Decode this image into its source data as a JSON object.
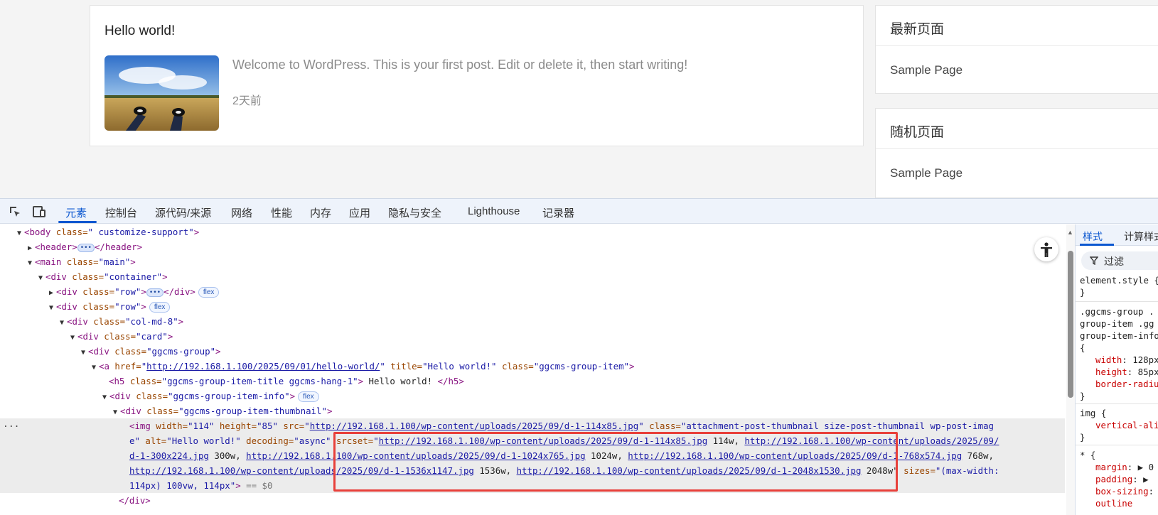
{
  "page": {
    "post": {
      "title": "Hello world!",
      "excerpt": "Welcome to WordPress. This is your first post. Edit or delete it, then start writing!",
      "time": "2天前"
    },
    "widgets": [
      {
        "title": "最新页面",
        "item": "Sample Page"
      },
      {
        "title": "随机页面",
        "item": "Sample Page"
      }
    ]
  },
  "devtools": {
    "toolbar_icons": [
      "inspect-element-icon",
      "device-toolbar-icon"
    ],
    "tabs": [
      {
        "label": "元素",
        "active": true
      },
      {
        "label": "控制台"
      },
      {
        "label": "源代码/来源"
      },
      {
        "label": "网络"
      },
      {
        "label": "性能"
      },
      {
        "label": "内存"
      },
      {
        "label": "应用"
      },
      {
        "label": "隐私与安全"
      },
      {
        "label": "Lighthouse"
      },
      {
        "label": "记录器"
      }
    ],
    "dom": {
      "body_tag": "<body",
      "body_attr": " class=",
      "body_val": "\" customize-support\"",
      "body_close": ">",
      "header_open": "<header>",
      "header_close": "</header>",
      "main_open": "<main",
      "main_attr": " class=",
      "main_val": "\"main\"",
      "container_open": "<div",
      "container_attr": " class=",
      "container_val": "\"container\"",
      "row_val": "\"row\"",
      "div_close": "</div>",
      "badge_flex": "flex",
      "col_val": "\"col-md-8\"",
      "card_val": "\"card\"",
      "group_val": "\"ggcms-group\"",
      "a_tag": "<a",
      "href_attr": " href=",
      "href_val": "http://192.168.1.100/2025/09/01/hello-world/",
      "title_attr": " title=",
      "title_val": "\"Hello world!\"",
      "a_class_val": "\"ggcms-group-item\"",
      "h5_tag": "<h5",
      "h5_class_val": "\"ggcms-group-item-title ggcms-hang-1\"",
      "h5_text": " Hello world! ",
      "h5_close": "</h5>",
      "info_val": "\"ggcms-group-item-info\"",
      "thumb_val": "\"ggcms-group-item-thumbnail\"",
      "img_line1_pre": "<img",
      "img_width_attr": " width=",
      "img_width_val": "\"114\"",
      "img_height_attr": " height=",
      "img_height_val": "\"85\"",
      "img_src_attr": " src=",
      "img_src_val": "http://192.168.1.100/wp-content/uploads/2025/09/d-1-114x85.jpg",
      "img_class_attr": " class=",
      "img_class_val": "\"attachment-post-thumbnail size-post-thumbnail wp-post-imag",
      "img_line2_a": "e\"",
      "img_alt_attr": " alt=",
      "img_alt_val": "\"Hello world!\"",
      "img_decoding_attr": " decoding=",
      "img_decoding_val": "\"async\"",
      "img_srcset_attr": " srcset=",
      "srcset_1": "http://192.168.1.100/wp-content/uploads/2025/09/d-1-114x85.jpg",
      "srcset_1w": " 114w, ",
      "srcset_2a": "http://192.168.1.100/wp-content/uploads/2025/09/",
      "srcset_2b": "d-1-300x224.jpg",
      "srcset_2w": " 300w, ",
      "srcset_3": "http://192.168.1.100/wp-content/uploads/2025/09/d-1-1024x765.jpg",
      "srcset_3w": " 1024w, ",
      "srcset_4": "http://192.168.1.100/wp-content/uploads/2025/09/d-1-768x574.jpg",
      "srcset_4w": " 768w,",
      "srcset_5": "http://192.168.1.100/wp-content/uploads/2025/09/d-1-1536x1147.jpg",
      "srcset_5w": " 1536w, ",
      "srcset_6": "http://192.168.1.100/wp-content/uploads/2025/09/d-1-2048x1530.jpg",
      "srcset_6w": " 2048w\"",
      "img_sizes_attr": " sizes=",
      "img_sizes_val_a": "\"(max-width:",
      "img_sizes_val_b": "114px) 100vw, 114px\"",
      "img_end": ">",
      "dollar_ref": " == $0",
      "gutter_dots": "...",
      "last_line": "</div>"
    },
    "styles_pane": {
      "tabs": [
        "样式",
        "计算样式"
      ],
      "filter_label": "过滤",
      "element_style": "element.style {",
      "brace_close": "}",
      "rule1_sel_1": ".ggcms-group .",
      "rule1_sel_2": "group-item .gg",
      "rule1_sel_3": "group-item-info",
      "brace_open": "{",
      "prop_width": "width",
      "val_width": ": 128px",
      "prop_height": "height",
      "val_height": ": 85px",
      "prop_border_radius": "border-radius",
      "rule2_sel": "img {",
      "prop_vertical_align": "vertical-align",
      "rule3_sel": "* {",
      "prop_margin": "margin",
      "val_margin": ": ▶ 0",
      "prop_padding": "padding",
      "val_padding": ": ▶",
      "prop_box_sizing": "box-sizing",
      "val_box_sizing": ": ▶",
      "prop_outline": "outline"
    }
  }
}
